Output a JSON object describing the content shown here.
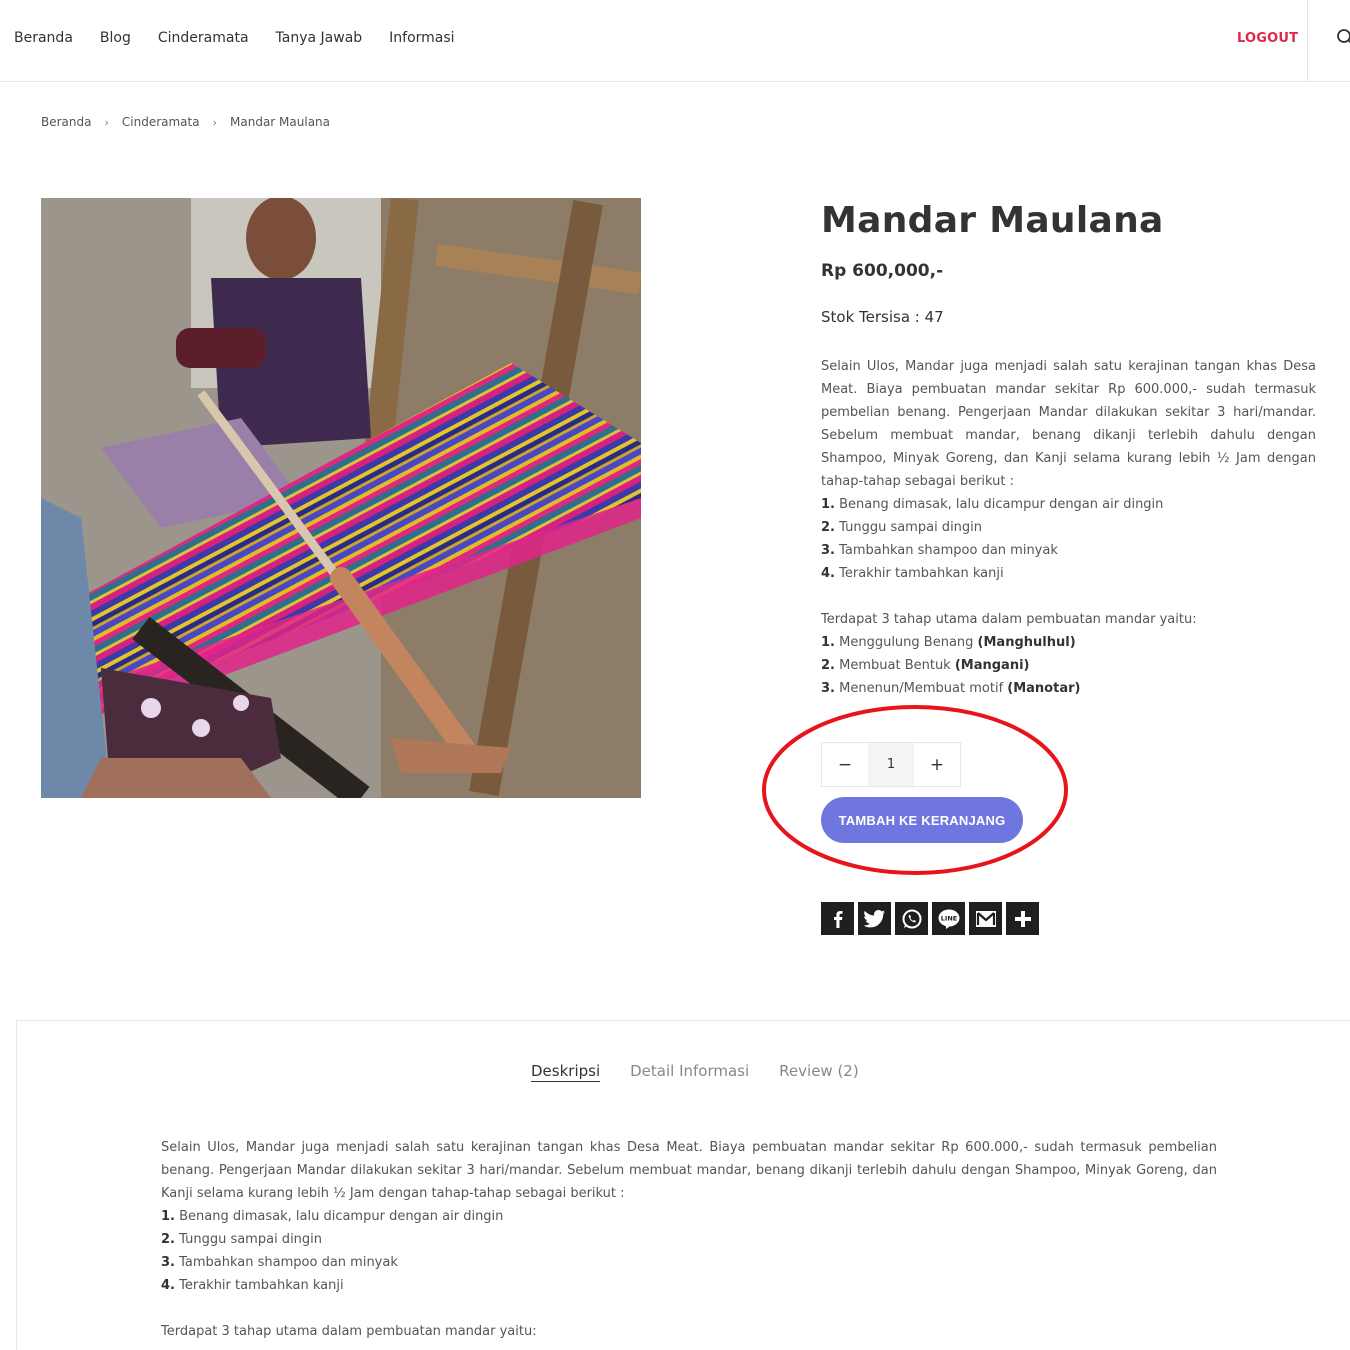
{
  "nav": {
    "items": [
      "Beranda",
      "Blog",
      "Cinderamata",
      "Tanya Jawab",
      "Informasi"
    ],
    "logout": "LOGOUT"
  },
  "breadcrumb": [
    "Beranda",
    "Cinderamata",
    "Mandar Maulana"
  ],
  "product": {
    "title": "Mandar Maulana",
    "price": "Rp 600,000,-",
    "stock": "Stok Tersisa : 47",
    "description_intro": "Selain Ulos, Mandar juga menjadi salah satu kerajinan tangan khas Desa Meat. Biaya pembuatan mandar sekitar Rp 600.000,- sudah termasuk pembelian benang. Pengerjaan Mandar dilakukan sekitar 3 hari/mandar. Sebelum membuat mandar, benang dikanji terlebih dahulu dengan Shampoo, Minyak Goreng, dan Kanji selama kurang lebih ½ Jam dengan tahap-tahap sebagai berikut :",
    "steps": [
      {
        "num": "1.",
        "text": "Benang dimasak, lalu dicampur dengan air dingin"
      },
      {
        "num": "2.",
        "text": "Tunggu sampai dingin"
      },
      {
        "num": "3.",
        "text": "Tambahkan shampoo dan minyak"
      },
      {
        "num": "4.",
        "text": "Terakhir tambahkan kanji"
      }
    ],
    "stages_intro": "Terdapat 3 tahap utama dalam pembuatan mandar yaitu:",
    "stages": [
      {
        "num": "1.",
        "text": "Menggulung Benang ",
        "term": "(Manghulhul)"
      },
      {
        "num": "2.",
        "text": "Membuat Bentuk ",
        "term": "(Mangani)"
      },
      {
        "num": "3.",
        "text": "Menenun/Membuat motif ",
        "term": "(Manotar)"
      }
    ],
    "quantity": {
      "minus": "−",
      "value": "1",
      "plus": "+"
    },
    "add_to_cart": "TAMBAH KE KERANJANG"
  },
  "share_icons": [
    "facebook-icon",
    "twitter-icon",
    "whatsapp-icon",
    "line-icon",
    "gmail-icon",
    "more-icon"
  ],
  "tabs": [
    {
      "label": "Deskripsi",
      "active": true
    },
    {
      "label": "Detail Informasi",
      "active": false
    },
    {
      "label": "Review (2)",
      "active": false
    }
  ],
  "colors": {
    "accent_button": "#7076e0",
    "logout": "#e0274b",
    "highlight_ellipse": "#e8141c"
  }
}
